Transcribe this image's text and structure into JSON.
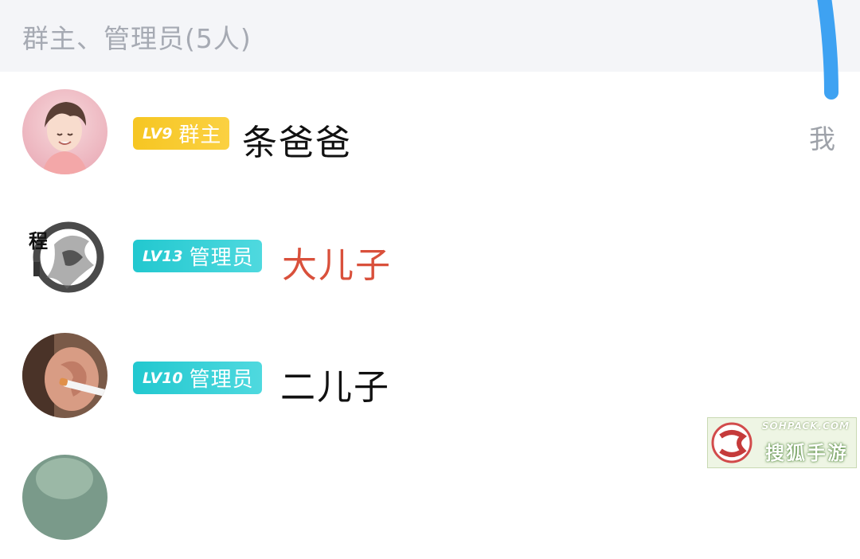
{
  "section": {
    "title": "群主、管理员(5人)"
  },
  "members": [
    {
      "level": "LV9",
      "role": "群主",
      "role_type": "owner",
      "name": "条爸爸",
      "name_color": "#111111",
      "is_me_label": "我",
      "avatar": "boy-illustration-avatar"
    },
    {
      "level": "LV13",
      "role": "管理员",
      "role_type": "admin",
      "name": "大儿子",
      "name_color": "#d9503b",
      "avatar": "ink-calligraphy-avatar"
    },
    {
      "level": "LV10",
      "role": "管理员",
      "role_type": "admin",
      "name": "二儿子",
      "name_color": "#111111",
      "avatar": "ear-photo-avatar"
    }
  ],
  "watermark": {
    "domain": "SOHPACK.COM",
    "name": "搜狐手游"
  },
  "colors": {
    "owner_badge": "#f6c622",
    "admin_badge": "#22c8cf",
    "scroll_thumb": "#3ea2f2",
    "header_bg": "#f4f5f8"
  }
}
